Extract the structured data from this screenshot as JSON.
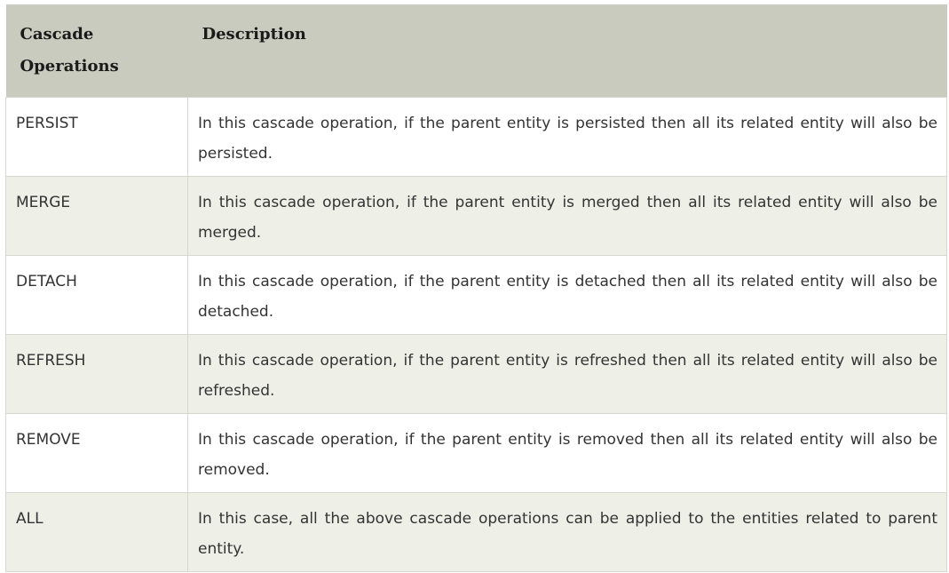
{
  "table": {
    "headers": [
      "Cascade Operations",
      "Description"
    ],
    "rows": [
      {
        "operation": "PERSIST",
        "description": "In this cascade operation, if the parent entity is persisted then all its related entity will also be persisted."
      },
      {
        "operation": "MERGE",
        "description": "In this cascade operation, if the parent entity is merged then all its related entity will also be merged."
      },
      {
        "operation": "DETACH",
        "description": "In this cascade operation, if the parent entity is detached then all its related entity will also be detached."
      },
      {
        "operation": "REFRESH",
        "description": "In this cascade operation, if the parent entity is refreshed then all its related entity will also be refreshed."
      },
      {
        "operation": "REMOVE",
        "description": "In this cascade operation, if the parent entity is removed then all its related entity will also be removed."
      },
      {
        "operation": "ALL",
        "description": "In this case, all the above cascade operations can be applied to the entities related to parent entity."
      }
    ]
  },
  "colors": {
    "header_bg": "#c8cbbd",
    "row_alt_bg": "#eef0e8",
    "row_bg": "#ffffff",
    "border": "#d6d8cf"
  }
}
